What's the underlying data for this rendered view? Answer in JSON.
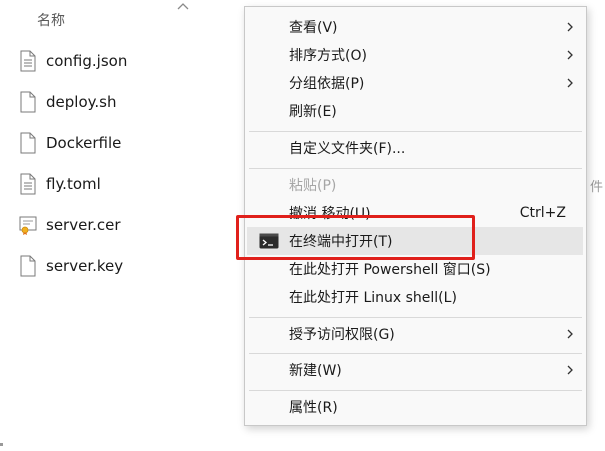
{
  "explorer": {
    "column_name": "名称",
    "files": [
      {
        "name": "config.json",
        "icon": "text-file-icon"
      },
      {
        "name": "deploy.sh",
        "icon": "blank-file-icon"
      },
      {
        "name": "Dockerfile",
        "icon": "blank-file-icon"
      },
      {
        "name": "fly.toml",
        "icon": "text-file-icon"
      },
      {
        "name": "server.cer",
        "icon": "certificate-icon"
      },
      {
        "name": "server.key",
        "icon": "blank-file-icon"
      }
    ],
    "edge_text": "件"
  },
  "menu": {
    "items": [
      {
        "label": "查看(V)",
        "submenu": true
      },
      {
        "label": "排序方式(O)",
        "submenu": true
      },
      {
        "label": "分组依据(P)",
        "submenu": true
      },
      {
        "label": "刷新(E)"
      },
      {
        "label": "自定义文件夹(F)..."
      },
      {
        "label": "粘贴(P)",
        "disabled": true
      },
      {
        "label": "撤消 移动(U)",
        "shortcut": "Ctrl+Z"
      },
      {
        "label": "在终端中打开(T)",
        "highlighted": true,
        "icon": "terminal-icon"
      },
      {
        "label": "在此处打开 Powershell 窗口(S)"
      },
      {
        "label": "在此处打开 Linux shell(L)"
      },
      {
        "label": "授予访问权限(G)",
        "submenu": true
      },
      {
        "label": "新建(W)",
        "submenu": true
      },
      {
        "label": "属性(R)"
      }
    ]
  },
  "colors": {
    "highlight_border": "#e0201b",
    "menu_background": "#f9f9f9",
    "hover_background": "#e6e6e6"
  }
}
